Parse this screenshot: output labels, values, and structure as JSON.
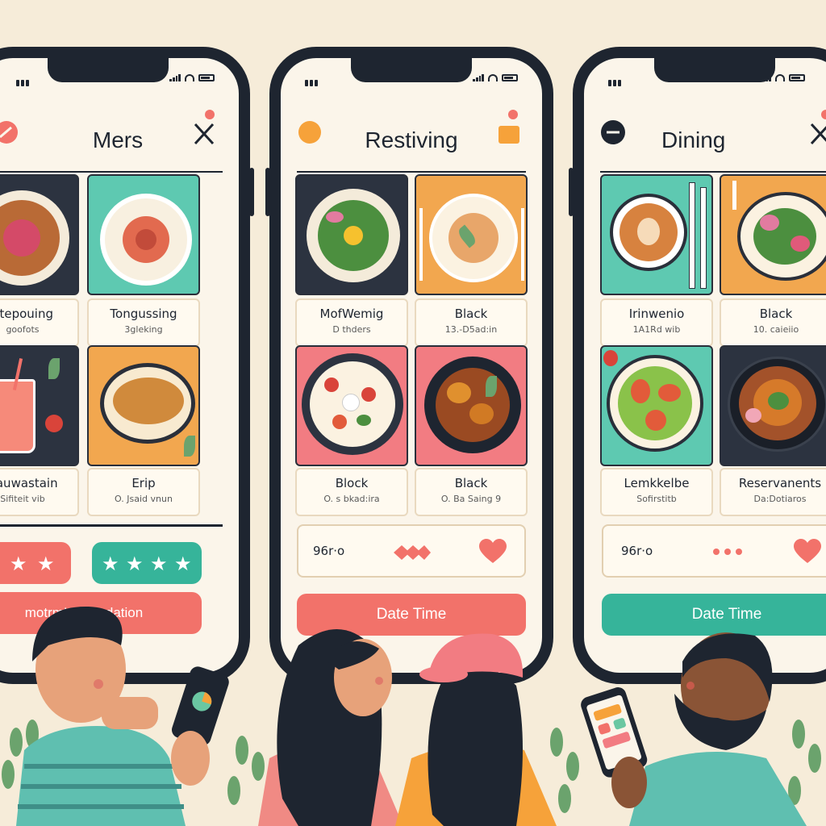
{
  "phones": [
    {
      "title": "Mers",
      "cards": [
        {
          "name": "Stepouing",
          "sub": "goofots"
        },
        {
          "name": "Tongussing",
          "sub": "3gleking"
        },
        {
          "name": "Cauwastain",
          "sub": "Sifiteit vib"
        },
        {
          "name": "Erip",
          "sub": "O. Jsaid vnun"
        }
      ],
      "action": "motrm!a resodation"
    },
    {
      "title": "Restiving",
      "cards": [
        {
          "name": "MofWemig",
          "sub": "D thders"
        },
        {
          "name": "Black",
          "sub": "13.-D5ad:in"
        },
        {
          "name": "Block",
          "sub": "O. s bkad:ira"
        },
        {
          "name": "Black",
          "sub": "O. Ba Saing 9"
        }
      ],
      "info_value": "96r·o",
      "action": "Date Time"
    },
    {
      "title": "Dining",
      "cards": [
        {
          "name": "Irinwenio",
          "sub": "1A1Rd wib"
        },
        {
          "name": "Black",
          "sub": "10. caieiio"
        },
        {
          "name": "Lemkkelbe",
          "sub": "Sofirstitb"
        },
        {
          "name": "Reservanents",
          "sub": "Da:Dotiaros"
        }
      ],
      "info_value": "96r·o",
      "action": "Date Time"
    }
  ],
  "colors": {
    "background": "#f6ecd9",
    "phone_frame": "#1e2530",
    "coral": "#f2726a",
    "teal": "#36b49a"
  },
  "icons": [
    "heart-icon",
    "star-icon",
    "close-icon",
    "dots-icon"
  ]
}
